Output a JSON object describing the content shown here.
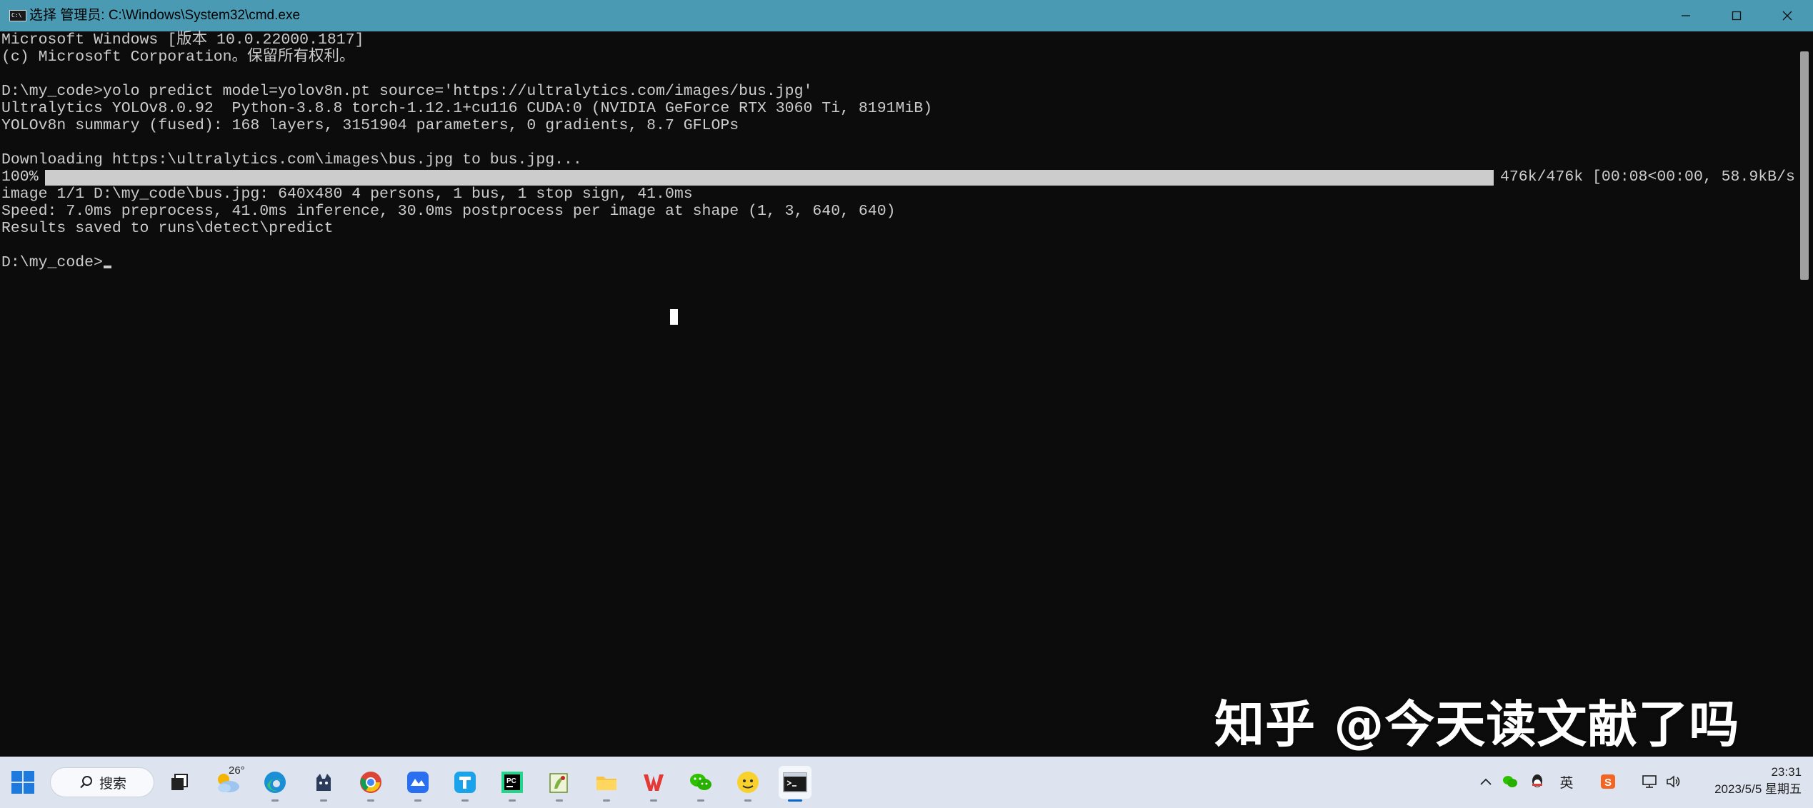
{
  "window": {
    "title": "选择 管理员: C:\\Windows\\System32\\cmd.exe",
    "icon_name": "cmd-icon"
  },
  "console": {
    "lines": [
      "Microsoft Windows [版本 10.0.22000.1817]",
      "(c) Microsoft Corporation。保留所有权利。",
      "",
      "D:\\my_code>yolo predict model=yolov8n.pt source='https://ultralytics.com/images/bus.jpg'",
      "Ultralytics YOLOv8.0.92  Python-3.8.8 torch-1.12.1+cu116 CUDA:0 (NVIDIA GeForce RTX 3060 Ti, 8191MiB)",
      "YOLOv8n summary (fused): 168 layers, 3151904 parameters, 0 gradients, 8.7 GFLOPs",
      "",
      "Downloading https:\\ultralytics.com\\images\\bus.jpg to bus.jpg...",
      "",
      "image 1/1 D:\\my_code\\bus.jpg: 640x480 4 persons, 1 bus, 1 stop sign, 41.0ms",
      "Speed: 7.0ms preprocess, 41.0ms inference, 30.0ms postprocess per image at shape (1, 3, 640, 640)",
      "Results saved to runs\\detect\\predict",
      "",
      "D:\\my_code>"
    ],
    "progress": {
      "percent_label": "100%",
      "fraction": 1.0,
      "stats": "476k/476k [00:08<00:00, 58.9kB/s]"
    }
  },
  "watermark": "知乎 @今天读文献了吗",
  "taskbar": {
    "search_label": "搜索",
    "weather_temp": "26°",
    "apps": [
      {
        "name": "task-view-icon",
        "active": false
      },
      {
        "name": "weather-icon",
        "active": false
      },
      {
        "name": "edge-browser-icon",
        "active": false
      },
      {
        "name": "cat-app-icon",
        "active": false
      },
      {
        "name": "chrome-browser-icon",
        "active": false
      },
      {
        "name": "feishu-app-icon",
        "active": false
      },
      {
        "name": "teambition-app-icon",
        "active": false
      },
      {
        "name": "pycharm-icon",
        "active": false
      },
      {
        "name": "notepad-plus-icon",
        "active": false
      },
      {
        "name": "file-explorer-icon",
        "active": false
      },
      {
        "name": "wps-office-icon",
        "active": false
      },
      {
        "name": "wechat-icon",
        "active": false
      },
      {
        "name": "qq-avatar-app-icon",
        "active": false
      },
      {
        "name": "terminal-icon",
        "active": true
      }
    ],
    "ime_label": "英",
    "clock_time": "23:31",
    "clock_date": "2023/5/5 星期五"
  },
  "colors": {
    "titlebar": "#4b9ab3",
    "console_bg": "#0c0c0c",
    "console_text": "#cccccc",
    "taskbar_bg": "#dde4ef"
  }
}
